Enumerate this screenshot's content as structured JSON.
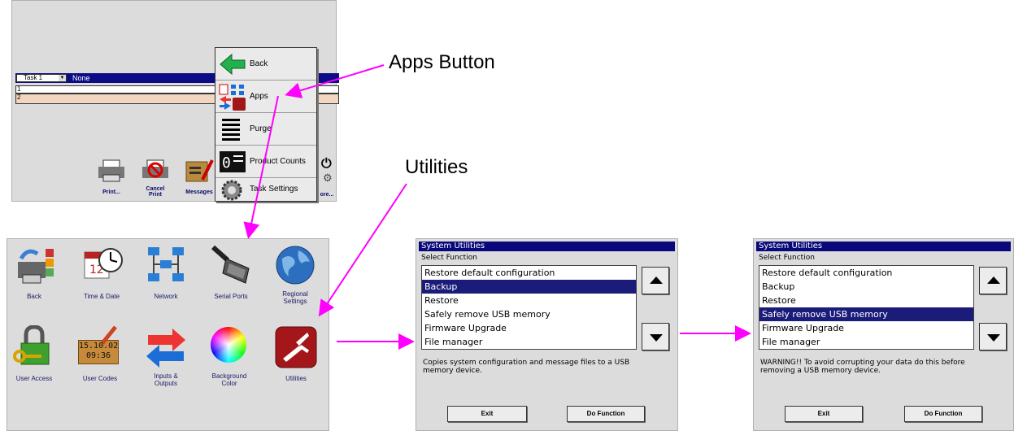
{
  "callouts": {
    "apps_button": "Apps Button",
    "utilities": "Utilities"
  },
  "main_screen": {
    "task_select": "Task 1",
    "task_value": "None",
    "rows": [
      "1",
      "2"
    ],
    "toolbar": {
      "print": "Print...",
      "cancel_print": "Cancel\nPrint",
      "messages": "Messages",
      "more": "ore..."
    }
  },
  "popup_menu": {
    "items": [
      {
        "label": "Back",
        "icon": "back-arrow-icon"
      },
      {
        "label": "Apps",
        "icon": "apps-icon"
      },
      {
        "label": "Purge",
        "icon": "purge-icon"
      },
      {
        "label": "Product Counts",
        "icon": "product-counts-icon"
      },
      {
        "label": "Task Settings",
        "icon": "gear-icon"
      }
    ]
  },
  "apps_screen": {
    "apps": [
      {
        "label": "Back",
        "icon": "back-printer-icon"
      },
      {
        "label": "Time & Date",
        "icon": "calendar-clock-icon"
      },
      {
        "label": "Network",
        "icon": "network-icon"
      },
      {
        "label": "Serial Ports",
        "icon": "serial-port-icon"
      },
      {
        "label": "Regional\nSettings",
        "icon": "globe-icon"
      },
      {
        "label": "User Access",
        "icon": "padlock-key-icon"
      },
      {
        "label": "User Codes",
        "icon": "user-codes-icon"
      },
      {
        "label": "Inputs &\nOutputs",
        "icon": "io-arrows-icon"
      },
      {
        "label": "Background\nColor",
        "icon": "color-wheel-icon"
      },
      {
        "label": "Utilities",
        "icon": "swiss-knife-icon"
      }
    ],
    "user_codes_text": {
      "line1": "15.10.02",
      "line2": "09:36"
    }
  },
  "utilities_1": {
    "title": "System Utilities",
    "subtitle": "Select Function",
    "items": [
      "Restore default configuration",
      "Backup",
      "Restore",
      "Safely remove USB memory",
      "Firmware Upgrade",
      "File manager"
    ],
    "selected_index": 1,
    "description": "Copies system configuration and message files to a USB memory device.",
    "exit_label": "Exit",
    "do_label": "Do Function"
  },
  "utilities_2": {
    "title": "System Utilities",
    "subtitle": "Select Function",
    "items": [
      "Restore default configuration",
      "Backup",
      "Restore",
      "Safely remove USB memory",
      "Firmware Upgrade",
      "File manager"
    ],
    "selected_index": 3,
    "description": "WARNING!! To avoid corrupting your data do this before removing a USB memory device.",
    "exit_label": "Exit",
    "do_label": "Do Function"
  },
  "colors": {
    "title_bar": "#08087a",
    "selected": "#1b1b7a",
    "arrow": "#ff00ff",
    "panel_bg": "#dcdcdc"
  }
}
